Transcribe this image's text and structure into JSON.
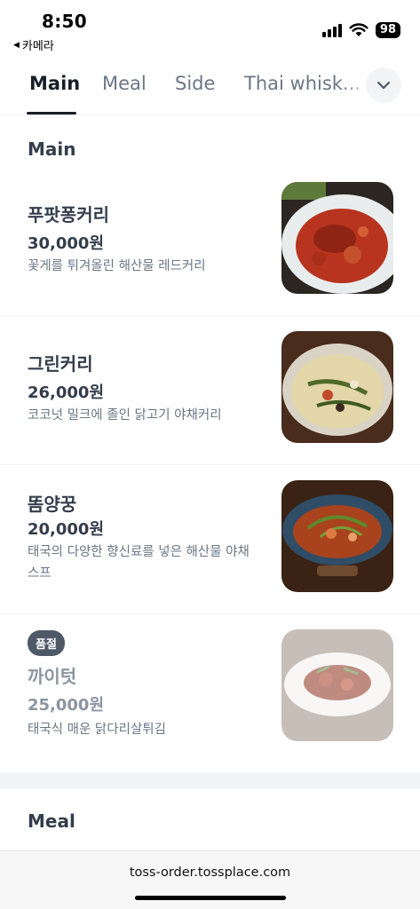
{
  "status": {
    "time": "8:50",
    "back_app": "카메라",
    "battery": "98"
  },
  "tabs": [
    {
      "label": "Main",
      "active": true
    },
    {
      "label": "Meal",
      "active": false
    },
    {
      "label": "Side",
      "active": false
    },
    {
      "label": "Thai whisk...",
      "active": false
    }
  ],
  "sections": {
    "main_title": "Main",
    "meal_title": "Meal"
  },
  "items": [
    {
      "name": "푸팟퐁커리",
      "price": "30,000원",
      "desc": "꽃게를 튀겨올린 해산물 레드커리",
      "sold_out": false
    },
    {
      "name": "그린커리",
      "price": "26,000원",
      "desc": "코코넛 밀크에 졸인 닭고기 야채커리",
      "sold_out": false
    },
    {
      "name": "똠양꿍",
      "price": "20,000원",
      "desc": "태국의 다양한 향신료를 넣은 해산물 야채스프",
      "sold_out": false
    },
    {
      "name": "까이텃",
      "price": "25,000원",
      "desc": "태국식 매운 닭다리살튀김",
      "sold_out": true,
      "badge": "품절"
    }
  ],
  "browser": {
    "url": "toss-order.tossplace.com"
  },
  "colors": {
    "text_primary": "#333d4b",
    "text_secondary": "#6b7684",
    "badge_bg": "#4e5968"
  }
}
